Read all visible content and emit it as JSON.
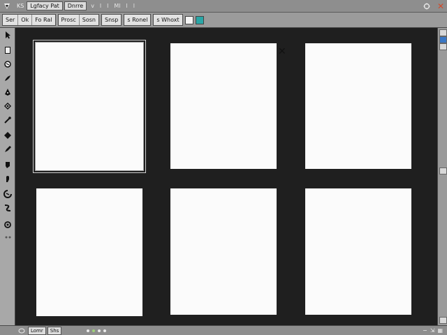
{
  "menu": {
    "items": [
      {
        "label": "KS",
        "style": "plain"
      },
      {
        "label": "Lgfacy Pat",
        "style": "boxed"
      },
      {
        "label": "Dnrre",
        "style": "boxed"
      },
      {
        "label": "v",
        "style": "dim"
      },
      {
        "label": "l",
        "style": "dim"
      },
      {
        "label": "l",
        "style": "dim"
      },
      {
        "label": "Ml",
        "style": "dim"
      },
      {
        "label": "l",
        "style": "dim"
      },
      {
        "label": "l",
        "style": "dim"
      }
    ]
  },
  "toolbar": {
    "group1": [
      "Ser",
      "Ok",
      "Fo Ral"
    ],
    "group2": [
      "Prosc",
      "Sosn"
    ],
    "group3": [
      "Snsp"
    ],
    "group4": [
      "s Ronel"
    ],
    "group5": [
      "s Whoxt"
    ]
  },
  "tools": [
    "arrow-tool-icon",
    "page-tool-icon",
    "lasso-tool-icon",
    "brush-tool-icon",
    "pen-tool-icon",
    "fill-tool-icon",
    "eyedropper-tool-icon",
    "diamond-tool-icon",
    "marker-tool-icon",
    "crop-tool-icon",
    "hand-tool-icon",
    "rotate-tool-icon",
    "warp-tool-icon",
    "zoom-tool-icon",
    "spiral-tool-icon"
  ],
  "pages": [
    {
      "id": 1,
      "selected": true
    },
    {
      "id": 2,
      "selected": false
    },
    {
      "id": 3,
      "selected": false
    },
    {
      "id": 4,
      "selected": false
    },
    {
      "id": 5,
      "selected": false
    },
    {
      "id": 6,
      "selected": false
    }
  ],
  "statusbar": {
    "field1": "Lomr",
    "field2": "Shs"
  },
  "colors": {
    "canvas": "#1f1f1f",
    "page": "#fbfbfb",
    "close": "#d24a2a",
    "accent": "#2aa6a6"
  }
}
